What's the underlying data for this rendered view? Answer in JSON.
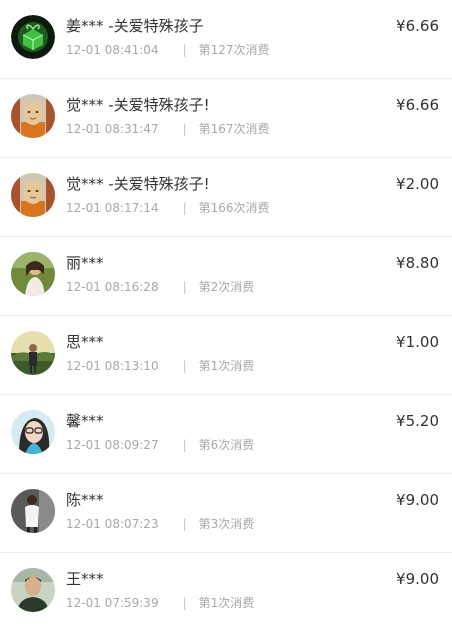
{
  "donations": [
    {
      "name": "姜*** -关爱特殊孩子",
      "time": "12-01 08:41:04",
      "sep": "|",
      "count": "第127次消费",
      "amount": "¥6.66",
      "avatar": "green-gift-avatar"
    },
    {
      "name": "觉*** -关爱特殊孩子!",
      "time": "12-01 08:31:47",
      "sep": "|",
      "count": "第167次消费",
      "amount": "¥6.66",
      "avatar": "monk-avatar"
    },
    {
      "name": "觉*** -关爱特殊孩子!",
      "time": "12-01 08:17:14",
      "sep": "|",
      "count": "第166次消费",
      "amount": "¥2.00",
      "avatar": "monk-avatar"
    },
    {
      "name": "丽***",
      "time": "12-01 08:16:28",
      "sep": "|",
      "count": "第2次消费",
      "amount": "¥8.80",
      "avatar": "woman-outdoor-avatar"
    },
    {
      "name": "思***",
      "time": "12-01 08:13:10",
      "sep": "|",
      "count": "第1次消费",
      "amount": "¥1.00",
      "avatar": "man-outdoor-avatar"
    },
    {
      "name": "馨***",
      "time": "12-01 08:09:27",
      "sep": "|",
      "count": "第6次消费",
      "amount": "¥5.20",
      "avatar": "girl-glasses-avatar"
    },
    {
      "name": "陈***",
      "time": "12-01 08:07:23",
      "sep": "|",
      "count": "第3次消费",
      "amount": "¥9.00",
      "avatar": "woman-white-avatar"
    },
    {
      "name": "王***",
      "time": "12-01 07:59:39",
      "sep": "|",
      "count": "第1次消费",
      "amount": "¥9.00",
      "avatar": "man-portrait-avatar"
    }
  ]
}
